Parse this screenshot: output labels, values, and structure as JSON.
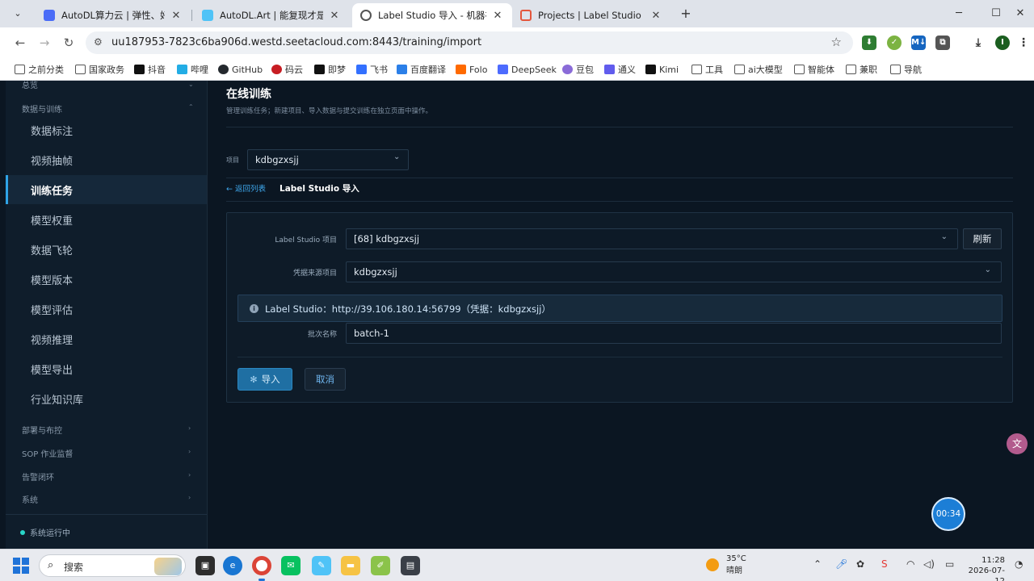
{
  "browser": {
    "tabs": [
      {
        "title": "AutoDL算力云 | 弹性、好用、省",
        "favicon_color": "#4a6cf7",
        "active": false
      },
      {
        "title": "AutoDL.Art | 能复现才是好算法",
        "favicon_color": "#4fc3f7",
        "active": false
      },
      {
        "title": "Label Studio 导入 - 机器视觉",
        "favicon_color": "#555555",
        "active": true
      },
      {
        "title": "Projects | Label Studio",
        "favicon_color": "#e4573d",
        "active": false
      }
    ],
    "url": "uu187953-7823c6ba906d.westd.seetacloud.com:8443/training/import",
    "bookmarks": [
      {
        "label": "之前分类",
        "icon": "folder-icon"
      },
      {
        "label": "国家政务",
        "icon": "folder-icon"
      },
      {
        "label": "抖音",
        "icon": "tiktok-icon"
      },
      {
        "label": "哔哩",
        "icon": "bilibili-icon"
      },
      {
        "label": "GitHub",
        "icon": "github-icon"
      },
      {
        "label": "码云",
        "icon": "gitee-icon"
      },
      {
        "label": "即梦",
        "icon": "jimeng-icon"
      },
      {
        "label": "飞书",
        "icon": "feishu-icon"
      },
      {
        "label": "百度翻译",
        "icon": "baidu-translate-icon"
      },
      {
        "label": "Folo",
        "icon": "folo-icon"
      },
      {
        "label": "DeepSeek",
        "icon": "deepseek-icon"
      },
      {
        "label": "豆包",
        "icon": "doubao-icon"
      },
      {
        "label": "通义",
        "icon": "tongyi-icon"
      },
      {
        "label": "Kimi",
        "icon": "kimi-icon"
      },
      {
        "label": "工具",
        "icon": "folder-icon"
      },
      {
        "label": "ai大模型",
        "icon": "folder-icon"
      },
      {
        "label": "智能体",
        "icon": "folder-icon"
      },
      {
        "label": "兼职",
        "icon": "folder-icon"
      },
      {
        "label": "导航",
        "icon": "folder-icon"
      }
    ],
    "extensions": [
      {
        "text": "⬇",
        "color": "#2e7d32"
      },
      {
        "text": "✓",
        "color": "#7cb342"
      },
      {
        "text": "M↓",
        "color": "#1565c0"
      },
      {
        "text": "⧉",
        "color": "#555555"
      }
    ],
    "profile_initial": "I"
  },
  "sidebar": {
    "top_cut_label": "总览",
    "group_data": "数据与训练",
    "items": [
      {
        "label": "数据标注"
      },
      {
        "label": "视频抽帧"
      },
      {
        "label": "训练任务"
      },
      {
        "label": "模型权重"
      },
      {
        "label": "数据飞轮"
      },
      {
        "label": "模型版本"
      },
      {
        "label": "模型评估"
      },
      {
        "label": "视频推理"
      },
      {
        "label": "模型导出"
      },
      {
        "label": "行业知识库"
      }
    ],
    "groups_bottom": [
      "部署与布控",
      "SOP 作业监督",
      "告警闭环",
      "系统"
    ],
    "status": "系统运行中"
  },
  "page": {
    "title": "在线训练",
    "subtitle": "管理训练任务；新建项目、导入数据与提交训练在独立页面中操作。",
    "project_label": "项目",
    "project_value": "kdbgzxsjj",
    "back_link": "← 返回列表",
    "breadcrumb_current": "Label Studio 导入"
  },
  "form": {
    "ls_project_label": "Label Studio 项目",
    "ls_project_value": "[68] kdbgzxsjj",
    "refresh_label": "刷新",
    "credential_label": "凭据来源项目",
    "credential_value": "kdbgzxsjj",
    "info_message": "Label Studio：http://39.106.180.14:56799（凭据：kdbgzxsjj）",
    "batch_label": "批次名称",
    "batch_value": "batch-1",
    "import_label": "导入",
    "cancel_label": "取消"
  },
  "overlay": {
    "timer": "00:34"
  },
  "taskbar": {
    "search_placeholder": "搜索",
    "weather_temp": "35°C",
    "weather_desc": "晴朗",
    "time": "11:28",
    "date": "2026-07-12"
  },
  "colors": {
    "accent": "#2fa3e6",
    "primary_button": "#1f6fa3",
    "link": "#3ea7ec",
    "status_dot": "#28d7c9"
  }
}
